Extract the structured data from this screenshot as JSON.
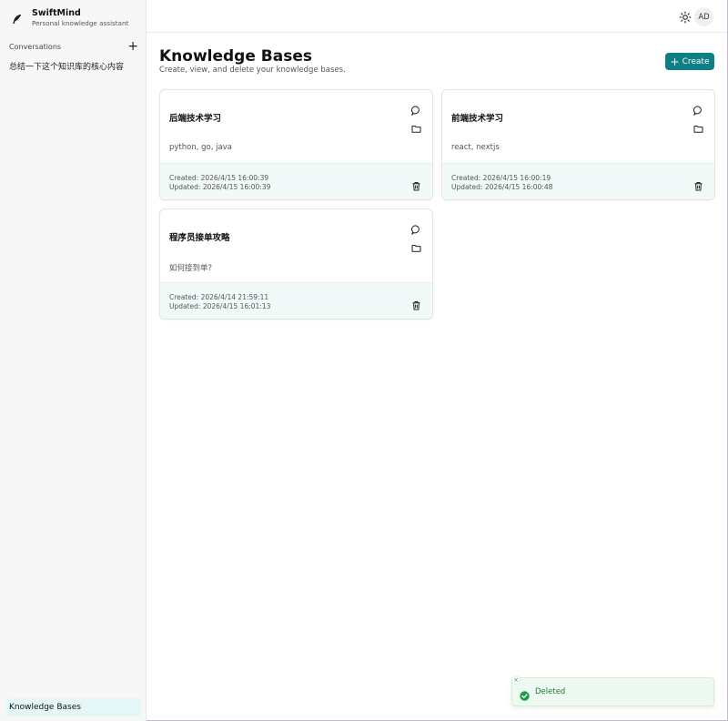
{
  "brand": {
    "name": "SwiftMind",
    "subtitle": "Personal knowledge assistant"
  },
  "sidebar": {
    "conversations_label": "Conversations",
    "conversations": [
      "总结一下这个知识库的核心内容"
    ],
    "nav_active": "Knowledge Bases"
  },
  "topbar": {
    "avatar_initials": "AD"
  },
  "main": {
    "title": "Knowledge Bases",
    "subtitle": "Create, view, and delete your knowledge bases.",
    "create_label": "Create"
  },
  "cards": [
    {
      "title": "后端技术学习",
      "description": "python, go, java",
      "created": "Created: 2026/4/15 16:00:39",
      "updated": "Updated: 2026/4/15 16:00:39"
    },
    {
      "title": "前端技术学习",
      "description": "react, nextjs",
      "created": "Created: 2026/4/15 16:00:19",
      "updated": "Updated: 2026/4/15 16:00:48"
    },
    {
      "title": "程序员接单攻略",
      "description": "如何接到单?",
      "created": "Created: 2026/4/14 21:59:11",
      "updated": "Updated: 2026/4/15 16:01:13"
    }
  ],
  "toast": {
    "message": "Deleted"
  },
  "colors": {
    "accent": "#0f7f86",
    "success": "#1f9a4a"
  }
}
